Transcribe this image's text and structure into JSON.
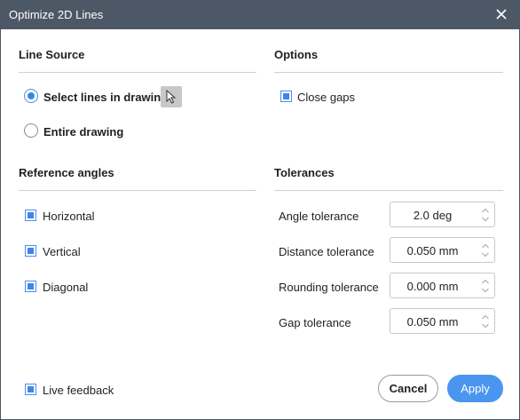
{
  "window": {
    "title": "Optimize 2D Lines"
  },
  "line_source": {
    "title": "Line Source",
    "select_lines_label": "Select lines in drawing",
    "select_lines_checked": true,
    "entire_drawing_label": "Entire drawing",
    "entire_drawing_checked": false
  },
  "options": {
    "title": "Options",
    "close_gaps_label": "Close gaps",
    "close_gaps_checked": true
  },
  "reference_angles": {
    "title": "Reference angles",
    "items": [
      {
        "label": "Horizontal",
        "checked": true
      },
      {
        "label": "Vertical",
        "checked": true
      },
      {
        "label": "Diagonal",
        "checked": true
      }
    ]
  },
  "tolerances": {
    "title": "Tolerances",
    "items": [
      {
        "label": "Angle tolerance",
        "value": "2.0 deg"
      },
      {
        "label": "Distance tolerance",
        "value": "0.050 mm"
      },
      {
        "label": "Rounding tolerance",
        "value": "0.000 mm"
      },
      {
        "label": "Gap tolerance",
        "value": "0.050 mm"
      }
    ]
  },
  "footer": {
    "live_feedback_label": "Live feedback",
    "live_feedback_checked": true,
    "cancel_label": "Cancel",
    "apply_label": "Apply"
  },
  "colors": {
    "titlebar": "#4d5867",
    "accent": "#3d86e6",
    "apply_button": "#4a95f0"
  }
}
